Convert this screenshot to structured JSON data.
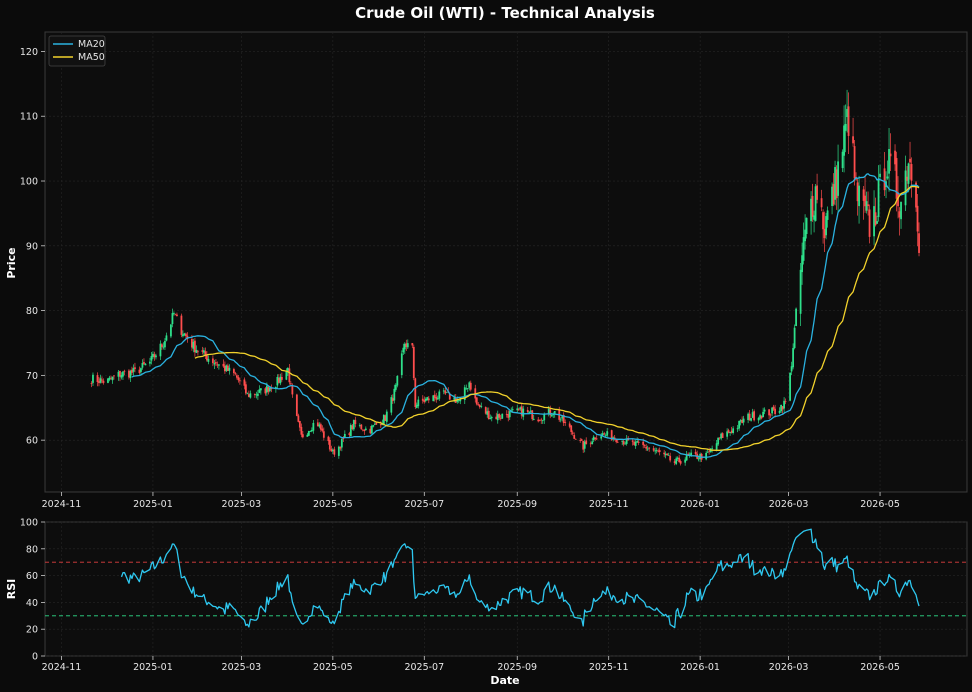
{
  "title": "Crude Oil (WTI) - Technical Analysis",
  "colors": {
    "background": "#0b0b0b",
    "panel": "#0d0d0d",
    "up": "#2ee08a",
    "down": "#ff4d4d",
    "ma20": "#2ab2e0",
    "ma50": "#f2d22c",
    "rsi": "#2ec8f0",
    "overbought": "#e04040",
    "oversold": "#2ee08a",
    "grid": "#262626"
  },
  "chart_data": [
    {
      "type": "candlestick",
      "title": "Crude Oil (WTI) - Technical Analysis",
      "xlabel": "",
      "ylabel": "Price",
      "xlim": [
        "2024-10-21",
        "2026-06-28"
      ],
      "ylim": [
        52,
        123
      ],
      "grid": true,
      "legend_position": "top-left",
      "yticks": [
        60,
        70,
        80,
        90,
        100,
        110,
        120
      ],
      "xticks": [
        "2024-11",
        "2025-01",
        "2025-03",
        "2025-05",
        "2025-07",
        "2025-09",
        "2025-11",
        "2026-01",
        "2026-03",
        "2026-05"
      ],
      "close_anchors": [
        [
          "2024-11-21",
          69.5
        ],
        [
          "2024-12-01",
          69.0
        ],
        [
          "2024-12-10",
          70.2
        ],
        [
          "2024-12-20",
          70.5
        ],
        [
          "2024-12-30",
          72.0
        ],
        [
          "2025-01-08",
          75.0
        ],
        [
          "2025-01-15",
          79.5
        ],
        [
          "2025-01-20",
          77.0
        ],
        [
          "2025-01-28",
          74.5
        ],
        [
          "2025-02-05",
          73.0
        ],
        [
          "2025-02-15",
          71.5
        ],
        [
          "2025-02-25",
          70.0
        ],
        [
          "2025-03-05",
          67.0
        ],
        [
          "2025-03-15",
          67.5
        ],
        [
          "2025-03-25",
          69.0
        ],
        [
          "2025-04-01",
          71.0
        ],
        [
          "2025-04-05",
          65.0
        ],
        [
          "2025-04-10",
          60.5
        ],
        [
          "2025-04-20",
          63.0
        ],
        [
          "2025-05-01",
          58.0
        ],
        [
          "2025-05-05",
          59.0
        ],
        [
          "2025-05-15",
          62.5
        ],
        [
          "2025-05-25",
          61.5
        ],
        [
          "2025-06-05",
          63.5
        ],
        [
          "2025-06-12",
          68.0
        ],
        [
          "2025-06-18",
          75.0
        ],
        [
          "2025-06-23",
          74.0
        ],
        [
          "2025-06-25",
          65.5
        ],
        [
          "2025-07-05",
          66.5
        ],
        [
          "2025-07-15",
          67.0
        ],
        [
          "2025-07-25",
          66.0
        ],
        [
          "2025-07-31",
          69.0
        ],
        [
          "2025-08-05",
          65.5
        ],
        [
          "2025-08-15",
          63.5
        ],
        [
          "2025-08-25",
          64.0
        ],
        [
          "2025-09-05",
          64.5
        ],
        [
          "2025-09-15",
          63.5
        ],
        [
          "2025-09-25",
          64.5
        ],
        [
          "2025-10-05",
          62.0
        ],
        [
          "2025-10-15",
          59.0
        ],
        [
          "2025-10-25",
          61.0
        ],
        [
          "2025-11-05",
          60.5
        ],
        [
          "2025-11-15",
          59.5
        ],
        [
          "2025-11-25",
          59.0
        ],
        [
          "2025-12-05",
          58.0
        ],
        [
          "2025-12-15",
          56.5
        ],
        [
          "2025-12-25",
          57.5
        ],
        [
          "2026-01-05",
          57.5
        ],
        [
          "2026-01-15",
          60.5
        ],
        [
          "2026-01-25",
          62.0
        ],
        [
          "2026-02-01",
          63.5
        ],
        [
          "2026-02-10",
          64.0
        ],
        [
          "2026-02-20",
          64.5
        ],
        [
          "2026-02-28",
          66.0
        ],
        [
          "2026-03-03",
          72.0
        ],
        [
          "2026-03-07",
          82.0
        ],
        [
          "2026-03-10",
          88.0
        ],
        [
          "2026-03-15",
          96.0
        ],
        [
          "2026-03-20",
          99.0
        ],
        [
          "2026-03-25",
          93.0
        ],
        [
          "2026-03-30",
          97.0
        ],
        [
          "2026-04-05",
          104.0
        ],
        [
          "2026-04-10",
          110.0
        ],
        [
          "2026-04-15",
          98.0
        ],
        [
          "2026-04-20",
          95.0
        ],
        [
          "2026-04-25",
          93.0
        ],
        [
          "2026-05-01",
          98.0
        ],
        [
          "2026-05-05",
          103.0
        ],
        [
          "2026-05-10",
          100.0
        ],
        [
          "2026-05-15",
          97.0
        ],
        [
          "2026-05-20",
          104.0
        ],
        [
          "2026-05-25",
          99.0
        ],
        [
          "2026-05-27",
          91.5
        ]
      ],
      "series": [
        {
          "name": "MA20",
          "color": "#2ab2e0"
        },
        {
          "name": "MA50",
          "color": "#f2d22c"
        }
      ]
    },
    {
      "type": "line",
      "xlabel": "Date",
      "ylabel": "RSI",
      "ylim": [
        0,
        100
      ],
      "yticks": [
        0,
        20,
        40,
        60,
        80,
        100
      ],
      "xticks": [
        "2024-11",
        "2025-01",
        "2025-03",
        "2025-05",
        "2025-07",
        "2025-09",
        "2025-11",
        "2026-01",
        "2026-03",
        "2026-05"
      ],
      "reference_lines": [
        70,
        30
      ],
      "grid": true
    }
  ]
}
